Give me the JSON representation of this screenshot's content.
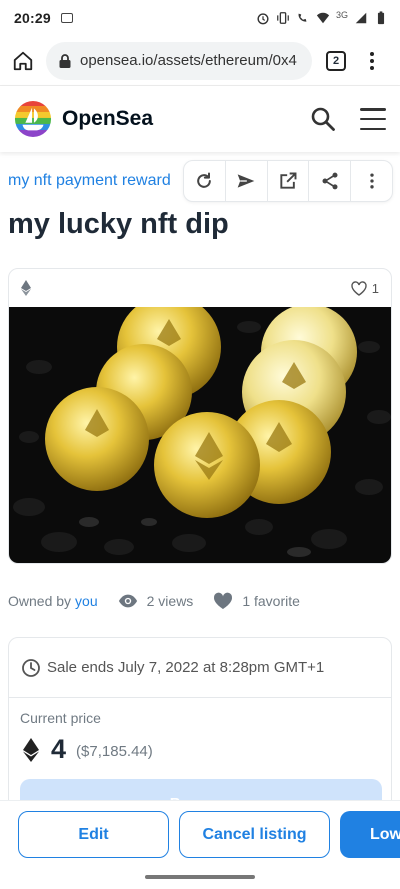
{
  "status_bar": {
    "time": "20:29",
    "network": "3G"
  },
  "browser": {
    "url": "opensea.io/assets/ethereum/0x4",
    "tab_count": "2"
  },
  "header": {
    "brand": "OpenSea"
  },
  "asset": {
    "collection": "my nft payment reward",
    "title": "my lucky nft dip",
    "favorites_count": "1"
  },
  "stats": {
    "owned_by_label": "Owned by",
    "owner": "you",
    "views": "2 views",
    "favorites": "1 favorite"
  },
  "sale": {
    "ends_text": "Sale ends July 7, 2022 at 8:28pm GMT+1",
    "current_price_label": "Current price",
    "price": "4",
    "price_usd": "($7,185.44)",
    "buy_now_label": "Buy now"
  },
  "actions": {
    "edit_label": "Edit",
    "cancel_label": "Cancel listing",
    "lower_label": "Lower price"
  },
  "colors": {
    "accent": "#2081e2",
    "text": "#1f2a37",
    "muted": "#707a83"
  }
}
